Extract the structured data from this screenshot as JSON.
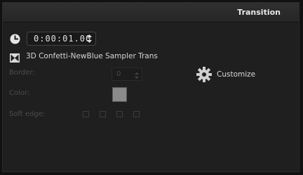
{
  "tab": {
    "title": "Transition"
  },
  "duration": {
    "timecode": "0:00:01.00"
  },
  "transition": {
    "name": "3D Confetti-NewBlue Sampler Trans"
  },
  "border": {
    "label": "Border:",
    "value": "0"
  },
  "color": {
    "label": "Color:",
    "swatch": "#8a8a8a"
  },
  "soft_edge": {
    "label": "Soft edge:",
    "options": [
      "none",
      "soft",
      "softer",
      "softest"
    ]
  },
  "customize": {
    "label": "Customize"
  }
}
